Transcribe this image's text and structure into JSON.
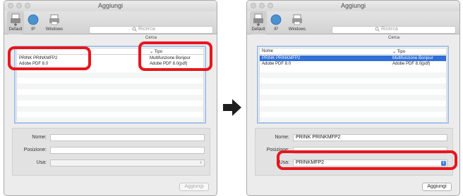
{
  "left_window": {
    "title": "Aggiungi",
    "toolbar": {
      "default_label": "Default",
      "ip_label": "IP",
      "windows_label": "Windows"
    },
    "search": {
      "placeholder": "Ricerca",
      "caption": "Cerca"
    },
    "list": {
      "header_type": "Tipo",
      "rows": [
        {
          "name": "PRINK PRINKMFP2",
          "type": "Multifunzione Bonjour"
        },
        {
          "name": "Adobe PDF 8.0",
          "type": "Adobe PDF 8.0(pdf)"
        }
      ]
    },
    "form": {
      "name_label": "Nome:",
      "location_label": "Posizione:",
      "use_label": "Usa:"
    },
    "button_label": "Aggiungi"
  },
  "right_window": {
    "title": "Aggiungi",
    "toolbar": {
      "default_label": "Default",
      "ip_label": "IP",
      "windows_label": "Windows"
    },
    "search": {
      "placeholder": "Ricerca",
      "caption": "Cerca"
    },
    "list": {
      "header_name": "Nome",
      "header_type": "Tipo",
      "rows": [
        {
          "name": "PRINK PRINKMFP2",
          "type": "Multifunzione Bonjour"
        },
        {
          "name": "Adobe PDF 8.0",
          "type": "Adobe PDF 8.0(pdf)"
        }
      ]
    },
    "form": {
      "name_label": "Nome:",
      "name_value": "PRINK PRINKMFP2",
      "location_label": "Posizione:",
      "use_label": "Usa:",
      "use_value": "PRINKMFP2"
    },
    "button_label": "Aggiungi"
  },
  "colors": {
    "highlight": "#e8161d",
    "selection": "#2f6fd7",
    "arrow": "#1e1e1e"
  },
  "icons": [
    "printer-icon",
    "globe-icon",
    "printer-icon",
    "search-icon",
    "chevron-down-icon",
    "arrow-right-icon"
  ]
}
